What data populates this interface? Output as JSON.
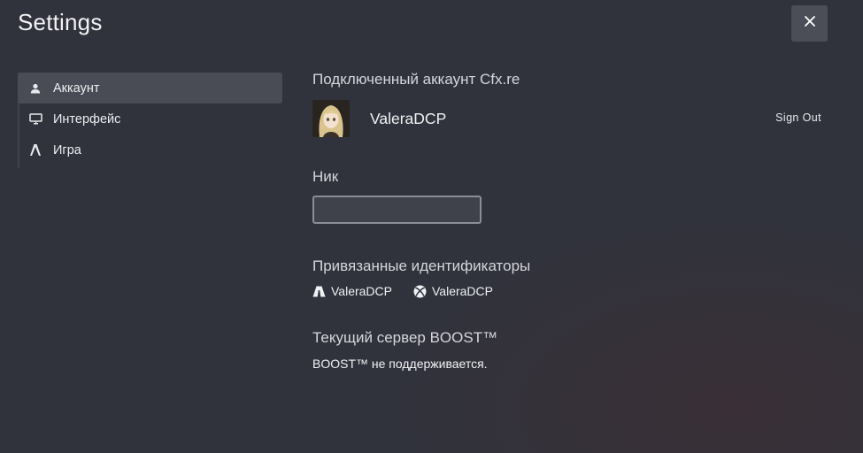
{
  "window": {
    "title": "Settings"
  },
  "sidebar": {
    "items": [
      {
        "label": "Аккаунт",
        "icon": "user-icon",
        "active": true
      },
      {
        "label": "Интерфейс",
        "icon": "monitor-icon",
        "active": false
      },
      {
        "label": "Игра",
        "icon": "game-icon",
        "active": false
      }
    ]
  },
  "account": {
    "section_title": "Подключенный аккаунт Cfx.re",
    "username": "ValeraDCP",
    "sign_out_label": "Sign Out"
  },
  "nickname": {
    "label": "Ник",
    "value": "",
    "placeholder": ""
  },
  "linked_ids": {
    "label": "Привязанные идентификаторы",
    "items": [
      {
        "icon": "rockstar-icon",
        "name": "ValeraDCP"
      },
      {
        "icon": "xbox-icon",
        "name": "ValeraDCP"
      }
    ]
  },
  "boost": {
    "label": "Текущий сервер BOOST™",
    "status": "BOOST™ не поддерживается."
  },
  "colors": {
    "background": "#30333c",
    "active_item": "#4a4c55",
    "close_button": "#4b4e57"
  }
}
